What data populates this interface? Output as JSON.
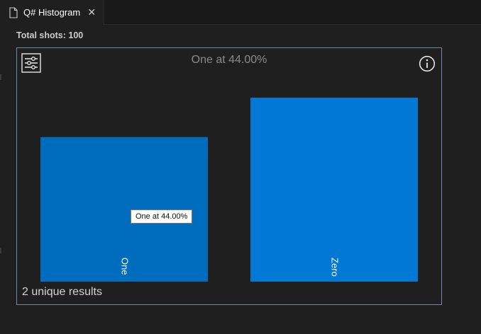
{
  "tab": {
    "label": "Q# Histogram",
    "close_glyph": "✕",
    "icon": "file-icon"
  },
  "summary": {
    "total_shots": "Total shots: 100"
  },
  "histogram": {
    "hovered_title": "One at 44.00%",
    "tooltip": "One at 44.00%",
    "unique_results": "2 unique results",
    "filter_icon": "sliders-icon",
    "info_icon": "info-icon"
  },
  "colors": {
    "bar": "#0078d4",
    "bar_hover": "#006cbe",
    "border": "#6e8ba3",
    "background": "#1f1f1f"
  },
  "chart_data": {
    "type": "bar",
    "categories": [
      "One",
      "Zero"
    ],
    "values": [
      44,
      56
    ],
    "unit": "%",
    "ylim": [
      0,
      56
    ],
    "grid": false,
    "xlabel": "",
    "ylabel": ""
  }
}
